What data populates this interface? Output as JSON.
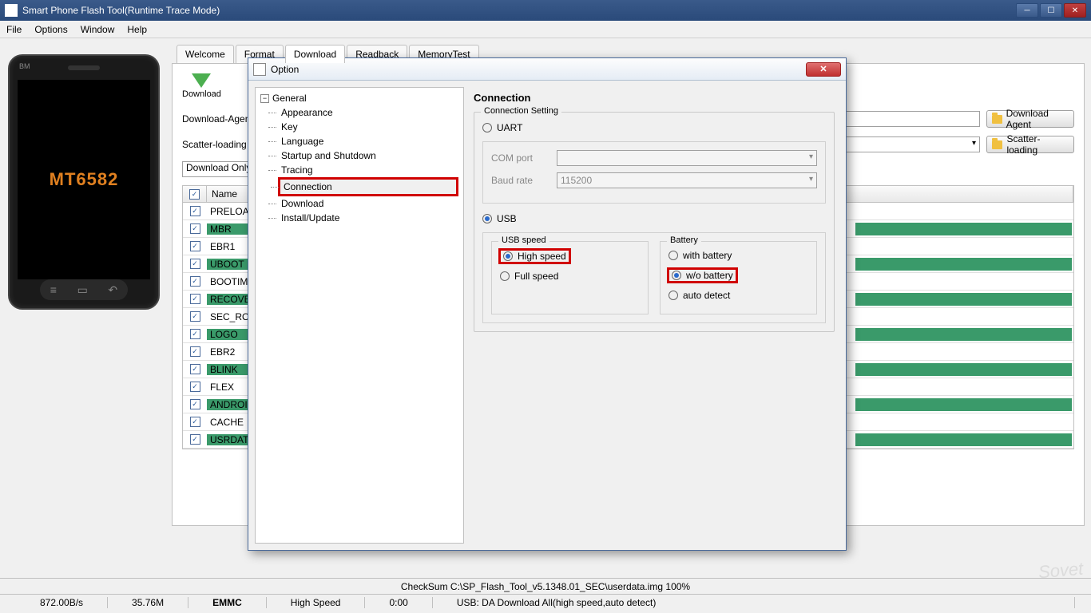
{
  "titlebar": {
    "title": "Smart Phone Flash Tool(Runtime Trace Mode)"
  },
  "menu": {
    "file": "File",
    "options": "Options",
    "window": "Window",
    "help": "Help"
  },
  "phone": {
    "bm": "BM",
    "model": "MT6582"
  },
  "tabs": {
    "welcome": "Welcome",
    "format": "Format",
    "download": "Download",
    "readback": "Readback",
    "memtest": "MemoryTest"
  },
  "download": {
    "download_label": "Download",
    "da_label": "Download-Agent",
    "scatter_label": "Scatter-loading",
    "btn_da": "Download Agent",
    "btn_scatter": "Scatter-loading",
    "mode": "Download Only",
    "col_name": "Name",
    "rows": [
      {
        "name": "PRELOADER",
        "bar": false
      },
      {
        "name": "MBR",
        "bar": true
      },
      {
        "name": "EBR1",
        "bar": false
      },
      {
        "name": "UBOOT",
        "bar": true
      },
      {
        "name": "BOOTIMG",
        "bar": false
      },
      {
        "name": "RECOVERY",
        "bar": true
      },
      {
        "name": "SEC_RO",
        "bar": false
      },
      {
        "name": "LOGO",
        "bar": true
      },
      {
        "name": "EBR2",
        "bar": false
      },
      {
        "name": "BLINK",
        "bar": true
      },
      {
        "name": "FLEX",
        "bar": false
      },
      {
        "name": "ANDROID",
        "bar": true
      },
      {
        "name": "CACHE",
        "bar": false
      },
      {
        "name": "USRDATA",
        "bar": true
      }
    ]
  },
  "dialog": {
    "title": "Option",
    "tree_root": "General",
    "tree": {
      "appearance": "Appearance",
      "key": "Key",
      "language": "Language",
      "startup": "Startup and Shutdown",
      "tracing": "Tracing",
      "connection": "Connection",
      "download": "Download",
      "install": "Install/Update"
    },
    "panel": {
      "title": "Connection",
      "setting_legend": "Connection Setting",
      "uart": "UART",
      "com_port": "COM port",
      "baud_rate": "Baud rate",
      "baud_value": "115200",
      "usb": "USB",
      "usb_speed_legend": "USB speed",
      "high_speed": "High speed",
      "full_speed": "Full speed",
      "battery_legend": "Battery",
      "with_battery": "with battery",
      "wo_battery": "w/o battery",
      "auto_detect": "auto detect"
    }
  },
  "status": {
    "checksum": "CheckSum C:\\SP_Flash_Tool_v5.1348.01_SEC\\userdata.img 100%",
    "speed": "872.00B/s",
    "total": "35.76M",
    "storage": "EMMC",
    "usb_speed": "High Speed",
    "time": "0:00",
    "mode": "USB: DA Download All(high speed,auto detect)"
  },
  "watermark": "Sovet"
}
